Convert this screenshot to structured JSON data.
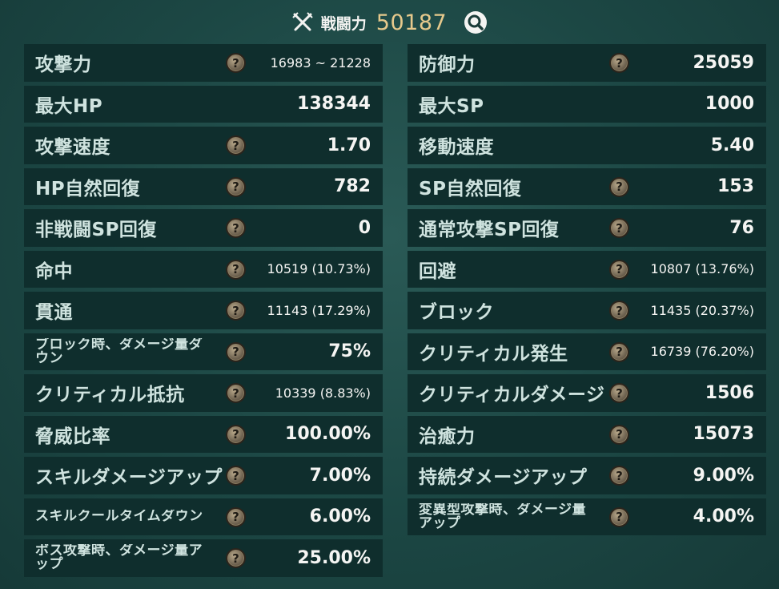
{
  "header": {
    "power_label": "戦闘力",
    "power_value": "50187"
  },
  "left_stats": [
    {
      "label": "攻撃力",
      "value": "16983 ~ 21228",
      "help": true,
      "small_value": true
    },
    {
      "label": "最大HP",
      "value": "138344",
      "help": false
    },
    {
      "label": "攻撃速度",
      "value": "1.70",
      "help": true
    },
    {
      "label": "HP自然回復",
      "value": "782",
      "help": true
    },
    {
      "label": "非戦闘SP回復",
      "value": "0",
      "help": true
    },
    {
      "label": "命中",
      "value": "10519 (10.73%)",
      "help": true,
      "small_value": true
    },
    {
      "label": "貫通",
      "value": "11143 (17.29%)",
      "help": true,
      "small_value": true
    },
    {
      "label": "ブロック時、ダメージ量ダウン",
      "value": "75%",
      "help": true,
      "small_label": true
    },
    {
      "label": "クリティカル抵抗",
      "value": "10339 (8.83%)",
      "help": true,
      "small_value": true
    },
    {
      "label": "脅威比率",
      "value": "100.00%",
      "help": true
    },
    {
      "label": "スキルダメージアップ",
      "value": "7.00%",
      "help": true
    },
    {
      "label": "スキルクールタイムダウン",
      "value": "6.00%",
      "help": true,
      "small_label": true
    },
    {
      "label": "ボス攻撃時、ダメージ量アップ",
      "value": "25.00%",
      "help": true,
      "small_label": true
    }
  ],
  "right_stats": [
    {
      "label": "防御力",
      "value": "25059",
      "help": true
    },
    {
      "label": "最大SP",
      "value": "1000",
      "help": false
    },
    {
      "label": "移動速度",
      "value": "5.40",
      "help": false
    },
    {
      "label": "SP自然回復",
      "value": "153",
      "help": true
    },
    {
      "label": "通常攻撃SP回復",
      "value": "76",
      "help": true
    },
    {
      "label": "回避",
      "value": "10807 (13.76%)",
      "help": true,
      "small_value": true
    },
    {
      "label": "ブロック",
      "value": "11435 (20.37%)",
      "help": true,
      "small_value": true
    },
    {
      "label": "クリティカル発生",
      "value": "16739 (76.20%)",
      "help": true,
      "small_value": true
    },
    {
      "label": "クリティカルダメージ",
      "value": "1506",
      "help": true
    },
    {
      "label": "治癒力",
      "value": "15073",
      "help": true
    },
    {
      "label": "持続ダメージアップ",
      "value": "9.00%",
      "help": true
    },
    {
      "label": "変異型攻撃時、ダメージ量アップ",
      "value": "4.00%",
      "help": true,
      "small_label": true
    }
  ],
  "help_glyph": "?",
  "colors": {
    "background": "#1c4744",
    "row": "#0f2e2d",
    "label": "#cfe3df",
    "value": "#f5f5f3",
    "power_value": "#e6c98c"
  }
}
